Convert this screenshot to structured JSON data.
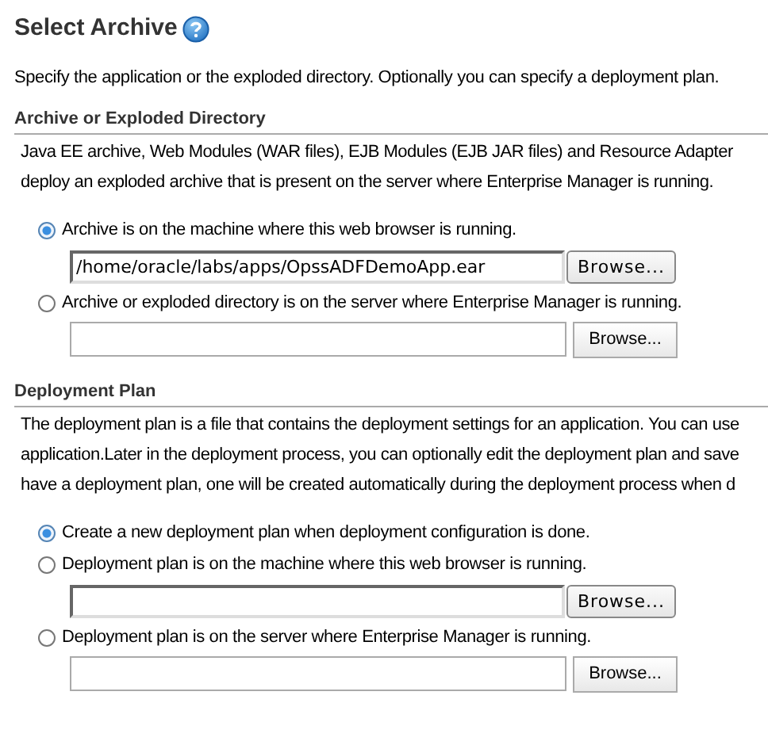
{
  "title": "Select Archive",
  "description": "Specify the application or the exploded directory. Optionally you can specify a deployment plan.",
  "sections": [
    {
      "heading": "Archive or Exploded Directory",
      "lines": [
        "Java EE archive, Web Modules (WAR files), EJB Modules (EJB JAR files) and Resource Adapter",
        "deploy an exploded archive that is present on the server where Enterprise Manager is running."
      ],
      "options": [
        {
          "label": "Archive is on the machine where this web browser is running.",
          "selected": true,
          "field": {
            "kind": "local",
            "value": "/home/oracle/labs/apps/OpssADFDemoApp.ear",
            "button": "Browse..."
          }
        },
        {
          "label": "Archive or exploded directory is on the server where Enterprise Manager is running.",
          "selected": false,
          "field": {
            "kind": "server",
            "button": "Browse..."
          }
        }
      ]
    },
    {
      "heading": "Deployment Plan",
      "lines": [
        "The deployment plan is a file that contains the deployment settings for an application. You can use",
        "application.Later in the deployment process, you can optionally edit the deployment plan and save",
        "have a deployment plan, one will be created automatically during the deployment process when d"
      ],
      "options": [
        {
          "label": "Create a new deployment plan when deployment configuration is done.",
          "selected": true
        },
        {
          "label": "Deployment plan is on the machine where this web browser is running.",
          "selected": false,
          "field": {
            "kind": "local",
            "button": "Browse..."
          }
        },
        {
          "label": "Deployment plan is on the server where Enterprise Manager is running.",
          "selected": false,
          "field": {
            "kind": "server",
            "button": "Browse..."
          }
        }
      ]
    }
  ]
}
